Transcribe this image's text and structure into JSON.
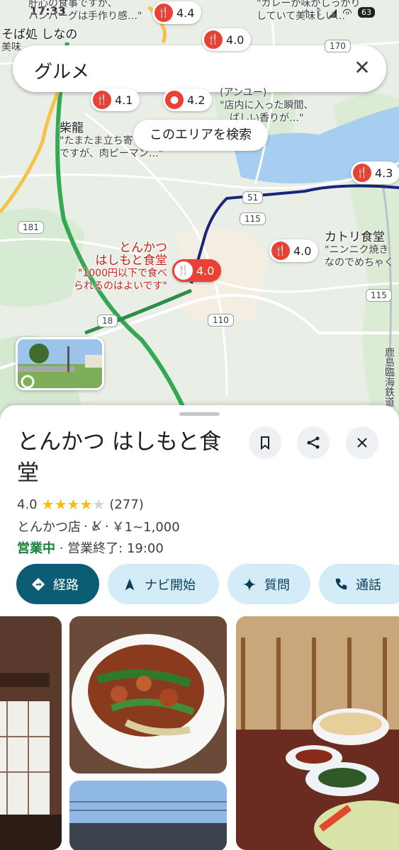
{
  "status_bar": {
    "time": "17:33",
    "battery": "63"
  },
  "search": {
    "query": "グルメ"
  },
  "map": {
    "search_area_label": "このエリアを検索",
    "pins": [
      {
        "rating": "4.4"
      },
      {
        "rating": "4.0"
      },
      {
        "rating": "4.1"
      },
      {
        "rating": "4.2"
      },
      {
        "rating": "4.3"
      },
      {
        "rating": "4.0"
      },
      {
        "rating": "4.0"
      }
    ],
    "labels": {
      "top_left_1": "肝心の食事ですが、",
      "top_left_2": "ハンバーグは手作り感…\"",
      "top_left_3": "そば処 しなの",
      "top_left_4": "美味",
      "top_right_1": "\"カレーが味がしっかり",
      "top_right_2": "していて美味しい…\"",
      "bubble_4_2_name": "(アンユー)",
      "bubble_4_2_review_1": "\"店内に入った瞬間、",
      "bubble_4_2_review_2": "…ばしい香りが…\"",
      "shiryu_name": "柴龍",
      "shiryu_review_1": "\"たまたま立ち寄ったの",
      "shiryu_review_2": "ですが、肉ピーマン…\"",
      "katori_name": "カトリ食堂",
      "katori_review_1": "\"ニンニク焼き",
      "katori_review_2": "なのでめちゃく",
      "selected_name_1": "とんかつ",
      "selected_name_2": "はしもと食堂",
      "selected_review_1": "\"1000円以下で食べ",
      "selected_review_2": "られるのはよいです\"",
      "railway": "鹿島臨海鉄道"
    },
    "route_shields": [
      "181",
      "115",
      "18",
      "110",
      "115",
      "51",
      "170"
    ]
  },
  "place": {
    "name": "とんかつ はしもと食堂",
    "rating": "4.0",
    "stars_filled": 4,
    "review_count": "(277)",
    "category": "とんかつ店",
    "price": "￥1~1,000",
    "open_status": "営業中",
    "closing": "· 営業終了: 19:00"
  },
  "actions": {
    "directions": "経路",
    "start_nav": "ナビ開始",
    "ask": "質問",
    "call": "通話"
  },
  "colors": {
    "accent": "#0b5d74",
    "chip": "#d3ecf8",
    "pin_red": "#e94235",
    "open_green": "#188038",
    "star": "#fbbc04",
    "route_blue": "#1a237e",
    "highway_green": "#2e7d32"
  }
}
